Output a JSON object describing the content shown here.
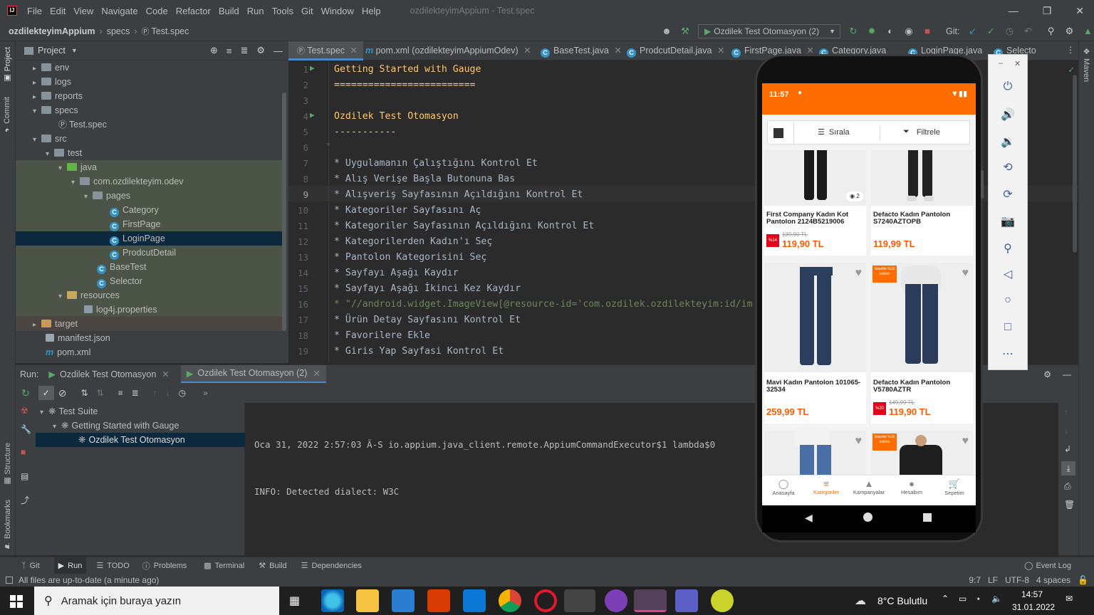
{
  "menu": {
    "items": [
      "File",
      "Edit",
      "View",
      "Navigate",
      "Code",
      "Refactor",
      "Build",
      "Run",
      "Tools",
      "Git",
      "Window",
      "Help"
    ],
    "window_title": "ozdilekteyimAppium - Test.spec"
  },
  "breadcrumb": {
    "project": "ozdilekteyimAppium",
    "folder": "specs",
    "file": "Test.spec"
  },
  "toolbar": {
    "run_config": "Ozdilek Test Otomasyon (2)",
    "git_label": "Git:"
  },
  "project_panel": {
    "header": "Project",
    "tree": [
      {
        "label": "env",
        "depth": 1,
        "kind": "folder",
        "expanded": false
      },
      {
        "label": "logs",
        "depth": 1,
        "kind": "folder",
        "expanded": false
      },
      {
        "label": "reports",
        "depth": 1,
        "kind": "folder",
        "expanded": false
      },
      {
        "label": "specs",
        "depth": 1,
        "kind": "folder",
        "expanded": true
      },
      {
        "label": "Test.spec",
        "depth": 2,
        "kind": "spec"
      },
      {
        "label": "src",
        "depth": 1,
        "kind": "folder",
        "expanded": true
      },
      {
        "label": "test",
        "depth": 2,
        "kind": "folder",
        "expanded": true
      },
      {
        "label": "java",
        "depth": 3,
        "kind": "folder-green",
        "expanded": true
      },
      {
        "label": "com.ozdilekteyim.odev",
        "depth": 4,
        "kind": "package",
        "expanded": true
      },
      {
        "label": "pages",
        "depth": 5,
        "kind": "package",
        "expanded": true
      },
      {
        "label": "Category",
        "depth": 6,
        "kind": "class"
      },
      {
        "label": "FirstPage",
        "depth": 6,
        "kind": "class"
      },
      {
        "label": "LoginPage",
        "depth": 6,
        "kind": "class",
        "selected": true
      },
      {
        "label": "ProdcutDetail",
        "depth": 6,
        "kind": "class"
      },
      {
        "label": "BaseTest",
        "depth": 5,
        "kind": "class"
      },
      {
        "label": "Selector",
        "depth": 5,
        "kind": "class"
      },
      {
        "label": "resources",
        "depth": 3,
        "kind": "folder-res",
        "expanded": true
      },
      {
        "label": "log4j.properties",
        "depth": 4,
        "kind": "props"
      },
      {
        "label": "target",
        "depth": 1,
        "kind": "folder-orange",
        "expanded": false
      },
      {
        "label": "manifest.json",
        "depth": 1,
        "kind": "json"
      },
      {
        "label": "pom.xml",
        "depth": 1,
        "kind": "maven"
      }
    ]
  },
  "editor_tabs": [
    "Test.spec",
    "pom.xml (ozdilekteyimAppiumOdev)",
    "BaseTest.java",
    "ProdcutDetail.java",
    "FirstPage.java",
    "Category.java",
    "LoginPage.java",
    "Selecto"
  ],
  "editor": {
    "lines": [
      {
        "n": "1",
        "text": "Getting Started with Gauge",
        "style": "heading"
      },
      {
        "n": "2",
        "text": "=========================",
        "style": "heading"
      },
      {
        "n": "3",
        "text": "",
        "style": "plain"
      },
      {
        "n": "4",
        "text": "Ozdilek Test Otomasyon",
        "style": "heading"
      },
      {
        "n": "5",
        "text": "-----------",
        "style": "heading"
      },
      {
        "n": "6",
        "text": "",
        "style": "plain"
      },
      {
        "n": "7",
        "text": "* Uygulamanın Çalıştığını Kontrol Et",
        "style": "step"
      },
      {
        "n": "8",
        "text": "* Alış Verişe Başla Butonuna Bas",
        "style": "step"
      },
      {
        "n": "9",
        "text": "* Alışveriş Sayfasının Açıldığını Kontrol Et",
        "style": "step"
      },
      {
        "n": "10",
        "text": "* Kategoriler Sayfasını Aç",
        "style": "step"
      },
      {
        "n": "11",
        "text": "* Kategoriler Sayfasının Açıldığını Kontrol Et",
        "style": "step"
      },
      {
        "n": "12",
        "text": "* Kategorilerden Kadın'ı Seç",
        "style": "step"
      },
      {
        "n": "13",
        "text": "* Pantolon Kategorisini Seç",
        "style": "step"
      },
      {
        "n": "14",
        "text": "* Sayfayı Aşağı Kaydır",
        "style": "step"
      },
      {
        "n": "15",
        "text": "* Sayfayı Aşağı İkinci Kez Kaydır",
        "style": "step"
      },
      {
        "n": "16",
        "text": "* \"//android.widget.ImageView[@resource-id='com.ozdilek.ozdilekteyim:id/im",
        "style": "string"
      },
      {
        "n": "17",
        "text": "* Ürün Detay Sayfasını Kontrol Et",
        "style": "step"
      },
      {
        "n": "18",
        "text": "* Favorilere Ekle",
        "style": "step"
      },
      {
        "n": "19",
        "text": "* Giris Yap Sayfasi Kontrol Et",
        "style": "step"
      }
    ]
  },
  "run": {
    "label": "Run:",
    "tabs": [
      "Ozdilek Test Otomasyon",
      "Ozdilek Test Otomasyon (2)"
    ],
    "tree": [
      {
        "label": "Test Suite",
        "depth": 0
      },
      {
        "label": "Getting Started with Gauge",
        "depth": 1
      },
      {
        "label": "Ozdilek Test Otomasyon",
        "depth": 2,
        "selected": true
      }
    ],
    "console": [
      "Oca 31, 2022 2:57:03 Ã-S io.appium.java_client.remote.AppiumCommandExecutor$1 lambda$0",
      "INFO: Detected dialect: W3C"
    ]
  },
  "bottom_tabs": [
    "Git",
    "Run",
    "TODO",
    "Problems",
    "Terminal",
    "Build",
    "Dependencies"
  ],
  "event_log": "Event Log",
  "status": {
    "message": "All files are up-to-date (a minute ago)",
    "position": "9:7",
    "line_sep": "LF",
    "encoding": "UTF-8",
    "indent": "4 spaces"
  },
  "taskbar": {
    "search_placeholder": "Aramak için buraya yazın",
    "weather": "8°C Bulutlu",
    "time": "14:57",
    "date": "31.01.2022"
  },
  "phone": {
    "status_time": "11:57",
    "sort_label": "Sırala",
    "filter_label": "Filtrele",
    "products": [
      {
        "name": "First Company Kadın Kot Pantolon 2124B5219006",
        "old_price": "139,90 TL",
        "price": "119,90 TL",
        "badge": "%14",
        "color_count": "2"
      },
      {
        "name": "Defacto Kadın Pantolon S7240AZTOPB",
        "old_price": "",
        "price": "119,99 TL"
      },
      {
        "name": "Mavi Kadın Pantolon 101065-32534",
        "old_price": "",
        "price": "259,99 TL"
      },
      {
        "name": "Defacto Kadın Pantolon V5780AZTR",
        "old_price": "149,99 TL",
        "price": "119,90 TL",
        "badge": "%20",
        "promo": "Sepette %10 indirim"
      },
      {
        "name": "",
        "old_price": "",
        "price": ""
      },
      {
        "name": "",
        "old_price": "",
        "price": "",
        "promo": "Sepette %10 indirim"
      }
    ],
    "nav": [
      "Anasayfa",
      "Kategoriler",
      "Kampanyalar",
      "Hesabım",
      "Sepetim"
    ],
    "nav_active": "Kategoriler"
  },
  "colors": {
    "accent_orange": "#ff6d00",
    "ide_bg": "#2b2b2b",
    "panel_bg": "#3c3f41",
    "selection": "#0d293e",
    "heading_text": "#ffc66d",
    "step_text": "#a9b7c6",
    "string_text": "#6a8759"
  }
}
